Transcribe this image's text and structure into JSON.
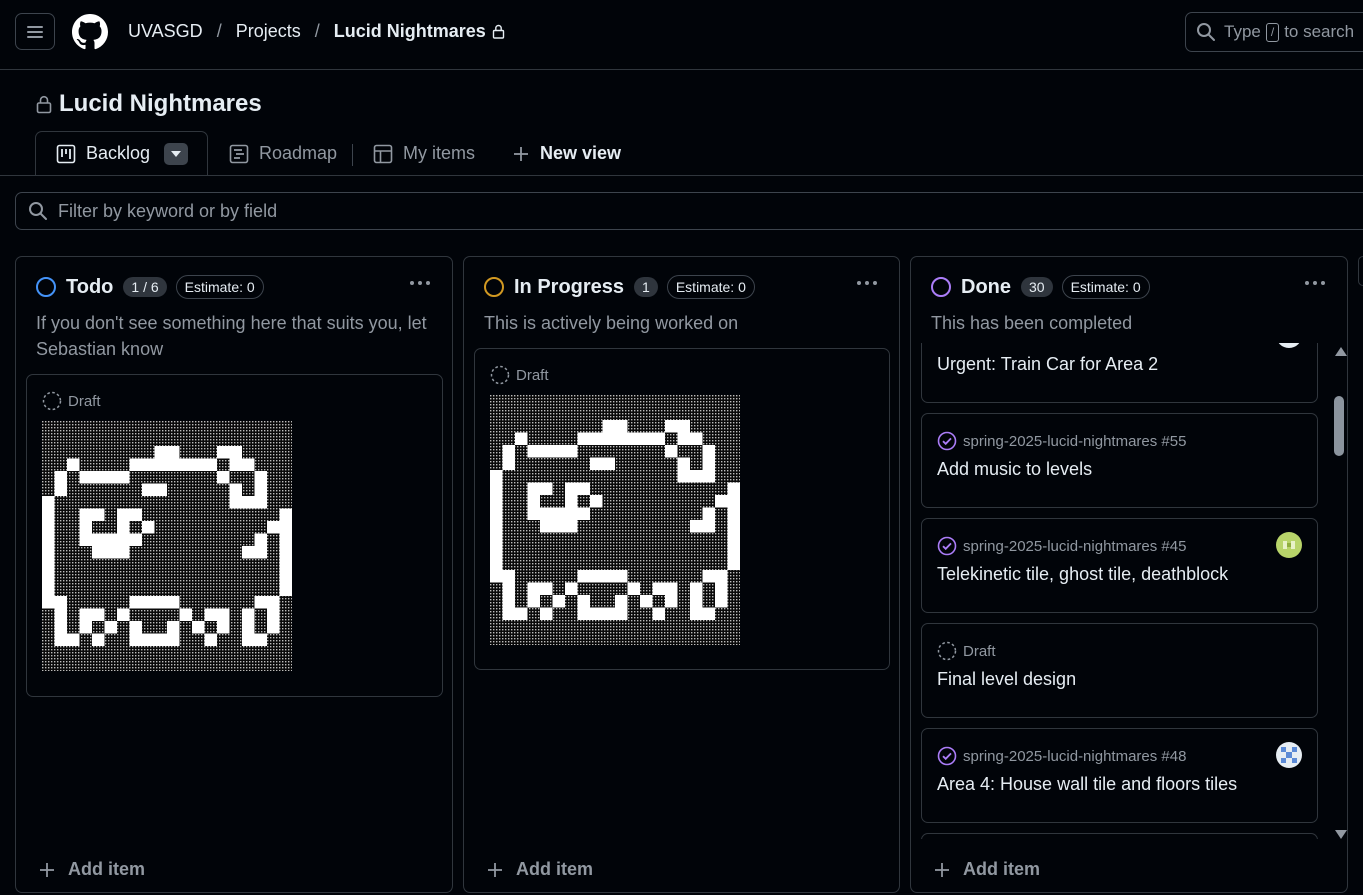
{
  "header": {
    "breadcrumbs": [
      "UVASGD",
      "Projects",
      "Lucid Nightmares"
    ],
    "search": {
      "prefix": "Type",
      "key": "/",
      "suffix": "to search"
    }
  },
  "project": {
    "title": "Lucid Nightmares"
  },
  "tabs": [
    {
      "label": "Backlog",
      "icon": "board-icon",
      "active": true
    },
    {
      "label": "Roadmap",
      "icon": "roadmap-icon"
    },
    {
      "label": "My items",
      "icon": "table-icon"
    },
    {
      "label": "New view",
      "icon": "plus-icon"
    }
  ],
  "filter": {
    "placeholder": "Filter by keyword or by field"
  },
  "columns": {
    "todo": {
      "name": "Todo",
      "count": "1 / 6",
      "estimate": "Estimate: 0",
      "description": "If you don't see something here that suits you, let Sebastian know",
      "color": "#4493f8",
      "cards": [
        {
          "type": "Draft"
        }
      ],
      "add_label": "Add item"
    },
    "in_progress": {
      "name": "In Progress",
      "count": "1",
      "estimate": "Estimate: 0",
      "description": "This is actively being worked on",
      "color": "#d29922",
      "cards": [
        {
          "type": "Draft"
        }
      ],
      "add_label": "Add item"
    },
    "done": {
      "name": "Done",
      "count": "30",
      "estimate": "Estimate: 0",
      "description": "This has been completed",
      "color": "#ab7df8",
      "cards": [
        {
          "meta": "",
          "title": "Urgent: Train Car for Area 2"
        },
        {
          "meta": "spring-2025-lucid-nightmares #55",
          "title": "Add music to levels",
          "icon": "issue-closed-icon"
        },
        {
          "meta": "spring-2025-lucid-nightmares #45",
          "title": "Telekinetic tile, ghost tile, deathblock",
          "icon": "issue-closed-icon",
          "avatar": "avatar-green"
        },
        {
          "meta": "Draft",
          "title": "Final level design",
          "icon": "draft-icon"
        },
        {
          "meta": "spring-2025-lucid-nightmares #48",
          "title": "Area 4: House wall tile and floors tiles",
          "icon": "issue-closed-icon",
          "avatar": "avatar-blue"
        }
      ],
      "add_label": "Add item"
    }
  }
}
